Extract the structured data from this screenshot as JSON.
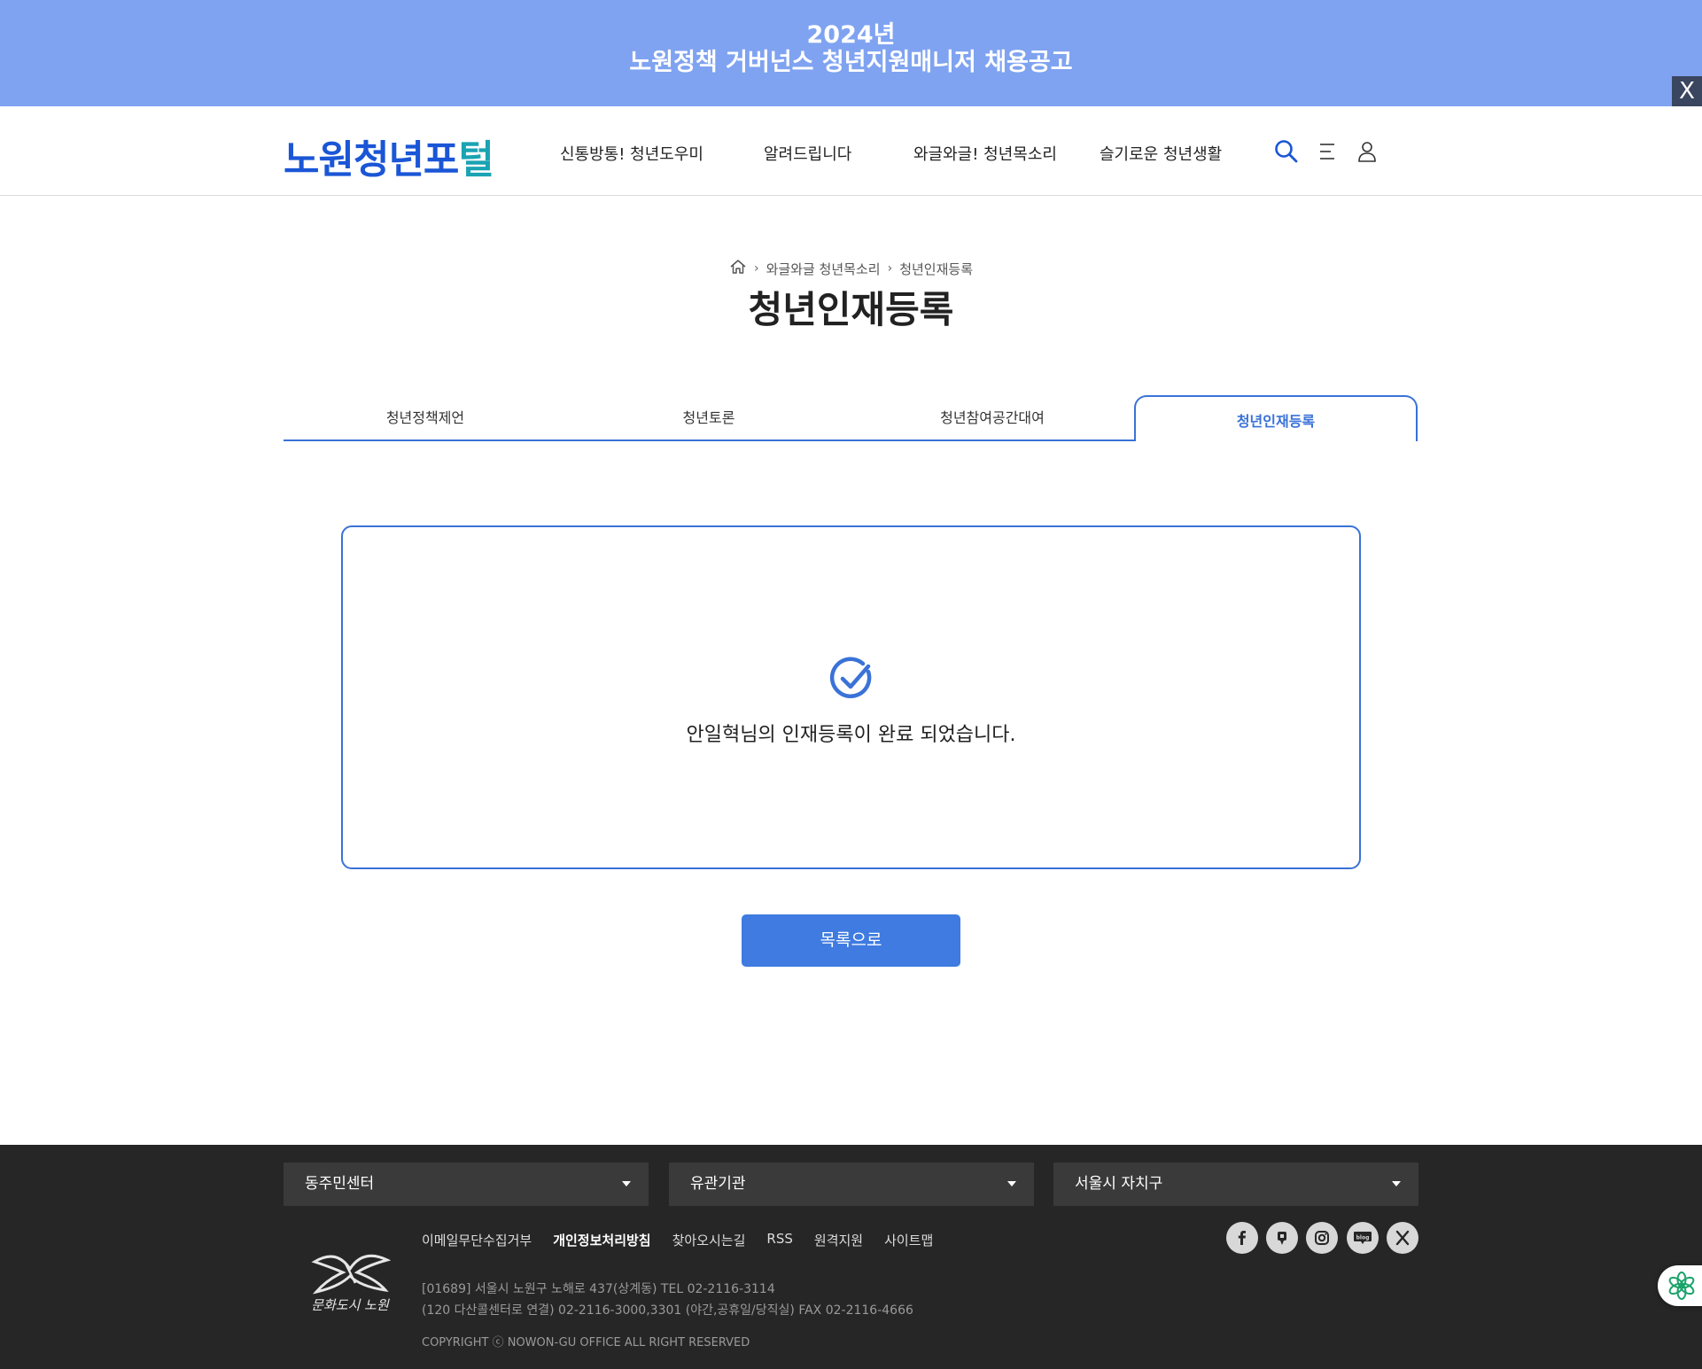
{
  "banner": {
    "line1": "2024년",
    "line2": "노원정책 거버넌스 청년지원매니저 채용공고",
    "close_label": "X"
  },
  "header": {
    "logo_main": "노원청년포",
    "logo_tail": "털",
    "nav": [
      "신통방통! 청년도우미",
      "알려드립니다",
      "와글와글! 청년목소리",
      "슬기로운 청년생활"
    ]
  },
  "breadcrumb": {
    "items": [
      "와글와글 청년목소리",
      "청년인재등록"
    ]
  },
  "page_title": "청년인재등록",
  "tabs": [
    "청년정책제언",
    "청년토론",
    "청년참여공간대여",
    "청년인재등록"
  ],
  "result": {
    "message": "안일혁님의 인재등록이 완료 되었습니다."
  },
  "list_button": "목록으로",
  "footer": {
    "selects": [
      "동주민센터",
      "유관기관",
      "서울시 자치구"
    ],
    "links": [
      "이메일무단수집거부",
      "개인정보처리방침",
      "찾아오시는길",
      "RSS",
      "원격지원",
      "사이트맵"
    ],
    "address_line1": "[01689] 서울시 노원구 노해로 437(상계동)      TEL 02-2116-3114",
    "address_line2": "(120 다산콜센터로 연결) 02-2116-3000,3301 (야간,공휴일/당직실)      FAX 02-2116-4666",
    "copyright": "COPYRIGHT ⓒ NOWON-GU OFFICE ALL RIGHT RESERVED",
    "emblem_text": "문화도시 노원",
    "social": [
      "facebook-icon",
      "kakao-story-icon",
      "instagram-icon",
      "blog-icon",
      "x-icon"
    ],
    "blog_label": "blog"
  },
  "colors": {
    "banner_bg": "#7fa3f1",
    "accent": "#3a72d8",
    "button": "#3f7be0",
    "footer_bg": "#262626"
  }
}
